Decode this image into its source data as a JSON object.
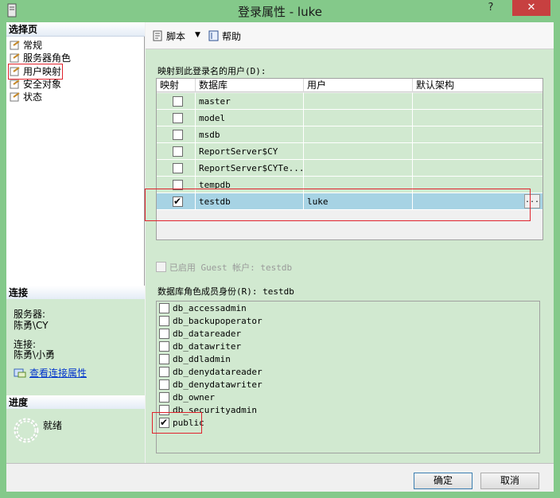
{
  "window": {
    "title": "登录属性 - luke",
    "help_glyph": "?",
    "close_glyph": "✕"
  },
  "left": {
    "select_page": "选择页",
    "pages": [
      "常规",
      "服务器角色",
      "用户映射",
      "安全对象",
      "状态"
    ],
    "connection_header": "连接",
    "server_label": "服务器:",
    "server_value": "陈勇\\CY",
    "conn_label": "连接:",
    "conn_value": "陈勇\\小勇",
    "view_conn_props": "查看连接属性",
    "progress_header": "进度",
    "progress_status": "就绪"
  },
  "toolbar": {
    "script": "脚本",
    "help": "帮助"
  },
  "mapping": {
    "label": "映射到此登录名的用户(D):",
    "columns": [
      "映射",
      "数据库",
      "用户",
      "默认架构"
    ],
    "rows": [
      {
        "db": "master",
        "user": "",
        "schema": "",
        "checked": false
      },
      {
        "db": "model",
        "user": "",
        "schema": "",
        "checked": false
      },
      {
        "db": "msdb",
        "user": "",
        "schema": "",
        "checked": false
      },
      {
        "db": "ReportServer$CY",
        "user": "",
        "schema": "",
        "checked": false
      },
      {
        "db": "ReportServer$CYTe...",
        "user": "",
        "schema": "",
        "checked": false
      },
      {
        "db": "tempdb",
        "user": "",
        "schema": "",
        "checked": false
      },
      {
        "db": "testdb",
        "user": "luke",
        "schema": "",
        "checked": true
      }
    ],
    "ellipsis": "..."
  },
  "guest": {
    "label": "已启用 Guest 帐户: testdb"
  },
  "roles": {
    "label": "数据库角色成员身份(R): testdb",
    "items": [
      {
        "name": "db_accessadmin",
        "checked": false
      },
      {
        "name": "db_backupoperator",
        "checked": false
      },
      {
        "name": "db_datareader",
        "checked": false
      },
      {
        "name": "db_datawriter",
        "checked": false
      },
      {
        "name": "db_ddladmin",
        "checked": false
      },
      {
        "name": "db_denydatareader",
        "checked": false
      },
      {
        "name": "db_denydatawriter",
        "checked": false
      },
      {
        "name": "db_owner",
        "checked": false
      },
      {
        "name": "db_securityadmin",
        "checked": false
      },
      {
        "name": "public",
        "checked": true
      }
    ]
  },
  "buttons": {
    "ok": "确定",
    "cancel": "取消"
  },
  "colors": {
    "frame": "#84c98a",
    "panel": "#d1e9d0",
    "selected_row": "#a7d3e4",
    "highlight": "#e0232d"
  }
}
